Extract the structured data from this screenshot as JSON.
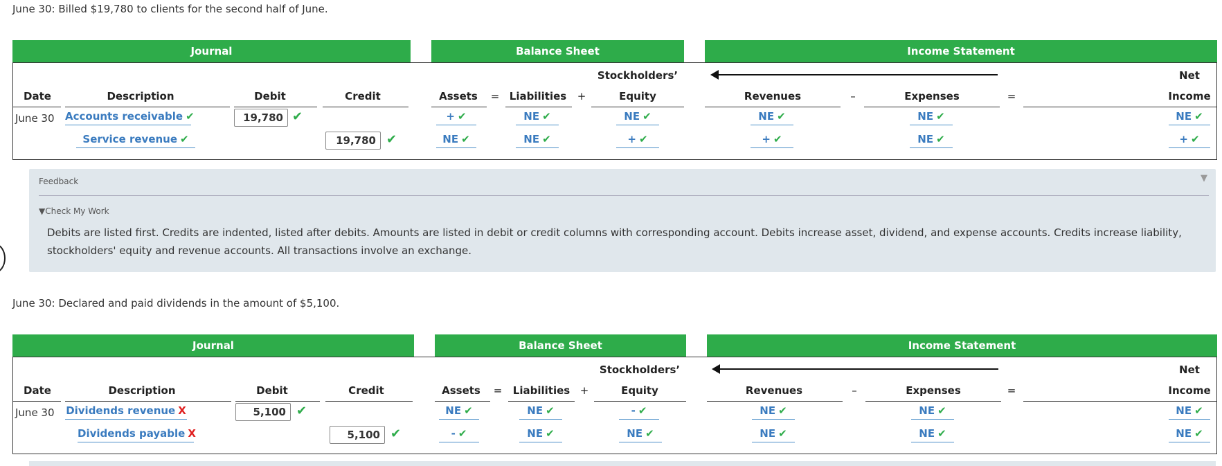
{
  "colors": {
    "band": "#2eac4a",
    "link": "#3a7bbf",
    "ok": "#2eac4a",
    "bad": "#e02020",
    "feedback_bg": "#e0e7ec"
  },
  "headers": {
    "journal": "Journal",
    "balance_sheet": "Balance Sheet",
    "income_statement": "Income Statement",
    "date": "Date",
    "description": "Description",
    "debit": "Debit",
    "credit": "Credit",
    "assets": "Assets",
    "liabilities": "Liabilities",
    "stockholders": "Stockholders’",
    "equity": "Equity",
    "revenues": "Revenues",
    "expenses": "Expenses",
    "net": "Net",
    "income": "Income",
    "eq": "=",
    "plus": "+",
    "minus": "–",
    "check": "✔",
    "cross": "X"
  },
  "transaction1": {
    "statement": "June 30: Billed $19,780 to clients for the second half of June.",
    "date": "June 30",
    "row1": {
      "account": "Accounts receivable",
      "account_status": "ok",
      "debit": "19,780",
      "assets": "+",
      "liabilities": "NE",
      "equity": "NE",
      "revenues": "NE",
      "expenses": "NE",
      "net_income": "NE"
    },
    "row2": {
      "account": "Service revenue",
      "account_status": "ok",
      "credit": "19,780",
      "assets": "NE",
      "liabilities": "NE",
      "equity": "+",
      "revenues": "+",
      "expenses": "NE",
      "net_income": "+"
    }
  },
  "feedback": {
    "title": "Feedback",
    "toggle": "▼",
    "check_my_work": "▼Check My Work",
    "text": "Debits are listed first. Credits are indented, listed after debits. Amounts are listed in debit or credit columns with corresponding account. Debits increase asset, dividend, and expense accounts. Credits increase liability, stockholders' equity and revenue accounts. All transactions involve an exchange."
  },
  "transaction2": {
    "statement": "June 30: Declared and paid dividends in the amount of $5,100.",
    "date": "June 30",
    "row1": {
      "account": "Dividends revenue",
      "account_status": "bad",
      "debit": "5,100",
      "assets": "NE",
      "liabilities": "NE",
      "equity": "-",
      "revenues": "NE",
      "expenses": "NE",
      "net_income": "NE"
    },
    "row2": {
      "account": "Dividends payable",
      "account_status": "bad",
      "credit": "5,100",
      "assets": "-",
      "liabilities": "NE",
      "equity": "NE",
      "revenues": "NE",
      "expenses": "NE",
      "net_income": "NE"
    }
  }
}
